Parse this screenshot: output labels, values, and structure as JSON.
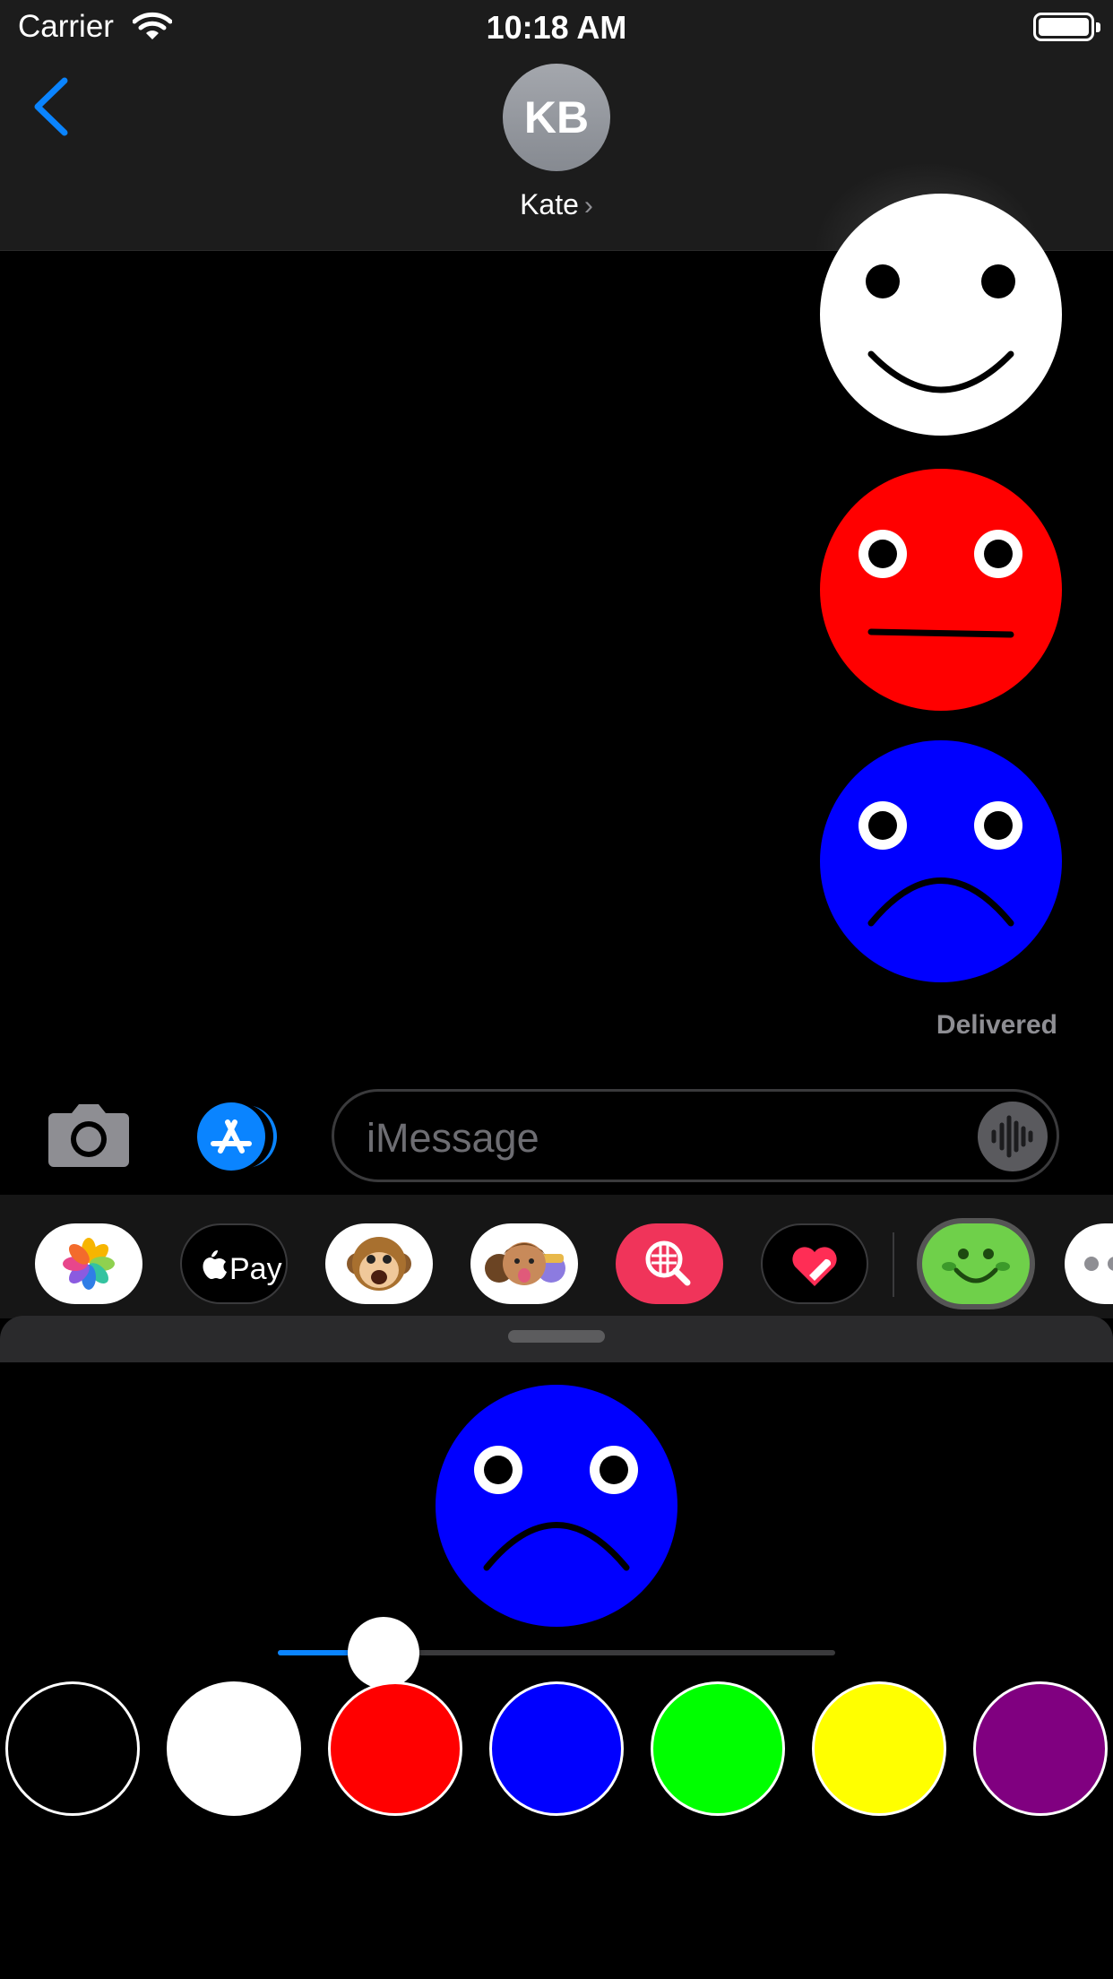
{
  "status_bar": {
    "carrier": "Carrier",
    "time": "10:18 AM",
    "icons": [
      "wifi-icon",
      "battery-icon"
    ]
  },
  "header": {
    "back_icon": "chevron-left-icon",
    "avatar_initials": "KB",
    "contact_name": "Kate",
    "contact_chevron": "›"
  },
  "conversation": {
    "stickers": [
      {
        "color": "#ffffff",
        "expression": "happy"
      },
      {
        "color": "#ff0000",
        "expression": "neutral"
      },
      {
        "color": "#0000ff",
        "expression": "sad"
      }
    ],
    "delivered_label": "Delivered"
  },
  "input_bar": {
    "camera_icon": "camera-icon",
    "appstore_icon": "app-store-icon",
    "placeholder": "iMessage",
    "audio_icon": "waveform-icon"
  },
  "app_drawer": {
    "apps": [
      {
        "name": "photos-app-icon"
      },
      {
        "name": "apple-pay-app-icon",
        "label": "Pay"
      },
      {
        "name": "animoji-app-icon"
      },
      {
        "name": "memoji-app-icon"
      },
      {
        "name": "image-search-app-icon"
      },
      {
        "name": "digital-touch-app-icon"
      },
      {
        "name": "smiley-sticker-app-icon",
        "selected": true
      },
      {
        "name": "more-apps-icon"
      }
    ]
  },
  "sticker_editor": {
    "preview": {
      "color": "#0000ff",
      "expression": "sad"
    },
    "slider_value": 0.19,
    "accent": "#0a84ff",
    "palette": [
      "#000000",
      "#ffffff",
      "#ff0000",
      "#0000ff",
      "#00ff00",
      "#ffff00",
      "#800080"
    ]
  }
}
